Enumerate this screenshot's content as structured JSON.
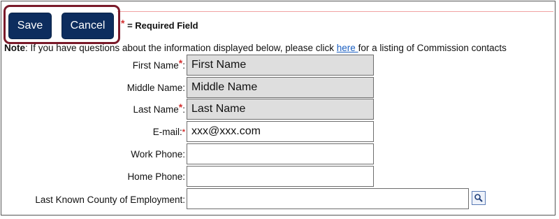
{
  "toolbar": {
    "save_label": "Save",
    "cancel_label": "Cancel"
  },
  "legend": {
    "star": "*",
    "text": "= Required Field"
  },
  "note": {
    "bold": "Note",
    "before": ": If you have questions about the information displayed below, please click ",
    "link": "here ",
    "after": "for a listing of Commission contacts"
  },
  "form": {
    "first_name": {
      "label": "First Name",
      "required": "*",
      "suffix": ":",
      "value": "First Name"
    },
    "middle_name": {
      "label": "Middle Name:",
      "value": "Middle Name"
    },
    "last_name": {
      "label": "Last Name",
      "required": "*",
      "suffix": ":",
      "value": "Last Name"
    },
    "email": {
      "label": "E-mail:",
      "required": "*",
      "value": "xxx@xxx.com"
    },
    "work_phone": {
      "label": "Work Phone:",
      "value": ""
    },
    "home_phone": {
      "label": "Home Phone:",
      "value": ""
    },
    "county": {
      "label": "Last Known County of Employment:",
      "value": "",
      "icon": "magnifier-icon"
    }
  },
  "colors": {
    "button": "#0d2d5e",
    "highlight": "#7a1a2a",
    "required": "#d32f2f",
    "link": "#1a5ec0",
    "readonly": "#dedede"
  }
}
